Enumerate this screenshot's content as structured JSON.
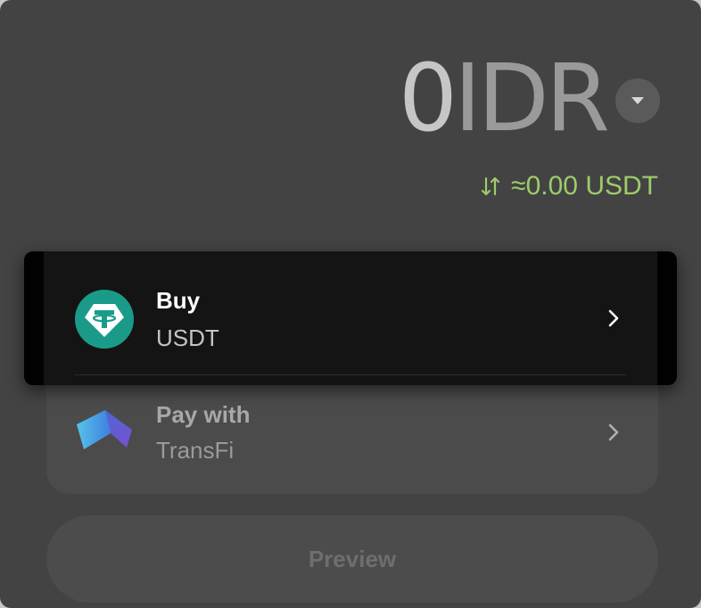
{
  "amount": {
    "value": "0",
    "currency": "IDR"
  },
  "conversion": {
    "text": "≈0.00 USDT"
  },
  "buy": {
    "title": "Buy",
    "asset": "USDT",
    "icon": "tether-icon"
  },
  "pay": {
    "title": "Pay with",
    "provider": "TransFi",
    "icon": "transfi-logo"
  },
  "preview": {
    "label": "Preview"
  },
  "colors": {
    "accent_green": "#9ccc6a",
    "tether": "#1a9b8a"
  }
}
